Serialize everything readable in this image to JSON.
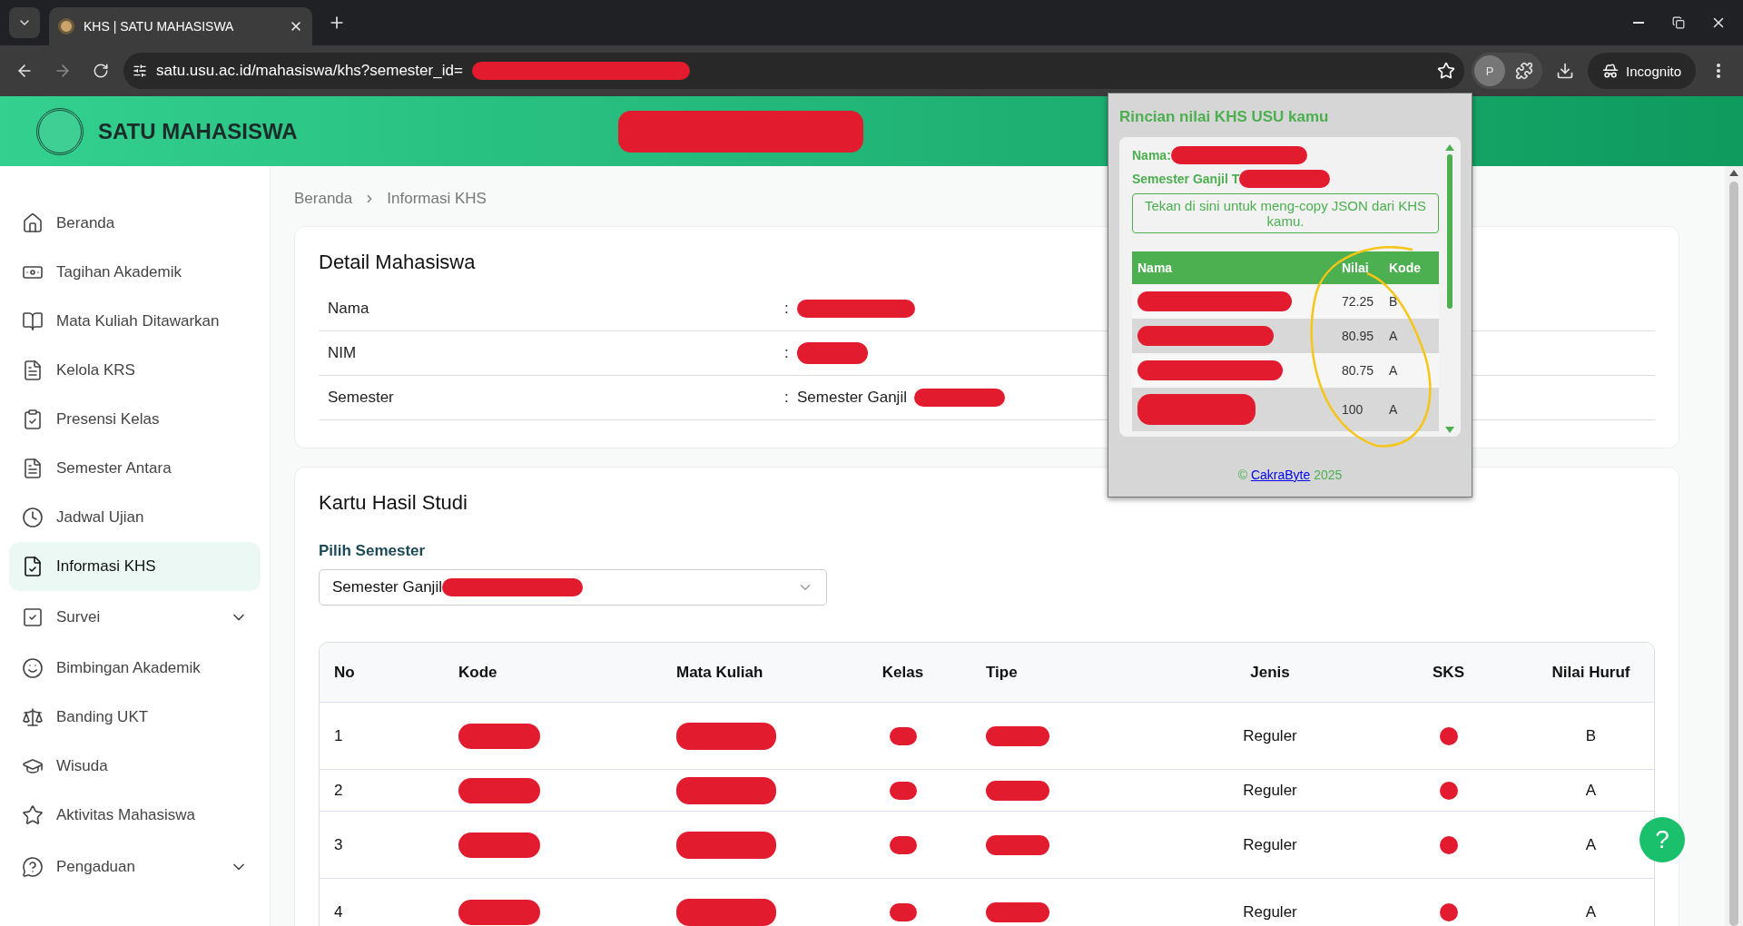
{
  "browser": {
    "tab_title": "KHS | SATU MAHASISWA",
    "url": "satu.usu.ac.id/mahasiswa/khs?semester_id=",
    "profile_initial": "P",
    "incognito_label": "Incognito"
  },
  "header": {
    "title": "SATU MAHASISWA"
  },
  "sidebar": {
    "items": [
      {
        "label": "Beranda",
        "selected": false,
        "expandable": false
      },
      {
        "label": "Tagihan Akademik",
        "selected": false,
        "expandable": false
      },
      {
        "label": "Mata Kuliah Ditawarkan",
        "selected": false,
        "expandable": false
      },
      {
        "label": "Kelola KRS",
        "selected": false,
        "expandable": false
      },
      {
        "label": "Presensi Kelas",
        "selected": false,
        "expandable": false
      },
      {
        "label": "Semester Antara",
        "selected": false,
        "expandable": false
      },
      {
        "label": "Jadwal Ujian",
        "selected": false,
        "expandable": false
      },
      {
        "label": "Informasi KHS",
        "selected": true,
        "expandable": false
      },
      {
        "label": "Survei",
        "selected": false,
        "expandable": true
      },
      {
        "label": "Bimbingan Akademik",
        "selected": false,
        "expandable": false
      },
      {
        "label": "Banding UKT",
        "selected": false,
        "expandable": false
      },
      {
        "label": "Wisuda",
        "selected": false,
        "expandable": false
      },
      {
        "label": "Aktivitas Mahasiswa",
        "selected": false,
        "expandable": false
      },
      {
        "label": "Pengaduan",
        "selected": false,
        "expandable": true
      }
    ]
  },
  "breadcrumb": [
    "Beranda",
    "Informasi KHS"
  ],
  "detail": {
    "title": "Detail Mahasiswa",
    "rows": [
      {
        "label": "Nama",
        "separator": ":"
      },
      {
        "label": "NIM",
        "separator": ":"
      },
      {
        "label": "Semester",
        "separator": ":",
        "value": "Semester Ganjil"
      }
    ]
  },
  "khs": {
    "title": "Kartu Hasil Studi",
    "select_label": "Pilih Semester",
    "select_value": "Semester Ganjil",
    "columns": [
      "No",
      "Kode",
      "Mata Kuliah",
      "Kelas",
      "Tipe",
      "Jenis",
      "SKS",
      "Nilai Huruf"
    ],
    "rows": [
      {
        "no": "1",
        "jenis": "Reguler",
        "nilai": "B"
      },
      {
        "no": "2",
        "jenis": "Reguler",
        "nilai": "A"
      },
      {
        "no": "3",
        "jenis": "Reguler",
        "nilai": "A"
      },
      {
        "no": "4",
        "jenis": "Reguler",
        "nilai": "A"
      }
    ]
  },
  "popup": {
    "title": "Rincian nilai KHS USU kamu",
    "name_label": "Nama:",
    "semester_label": "Semester Ganjil T",
    "copy_button": "Tekan di sini untuk meng-copy JSON dari KHS kamu.",
    "columns": [
      "Nama",
      "Nilai",
      "Kode"
    ],
    "rows": [
      {
        "nilai": "72.25",
        "kode": "B"
      },
      {
        "nilai": "80.95",
        "kode": "A"
      },
      {
        "nilai": "80.75",
        "kode": "A"
      },
      {
        "nilai": "100",
        "kode": "A"
      }
    ],
    "footer_symbol": "©",
    "footer_link": "CakraByte",
    "footer_year": "2025"
  },
  "help_button": "?"
}
